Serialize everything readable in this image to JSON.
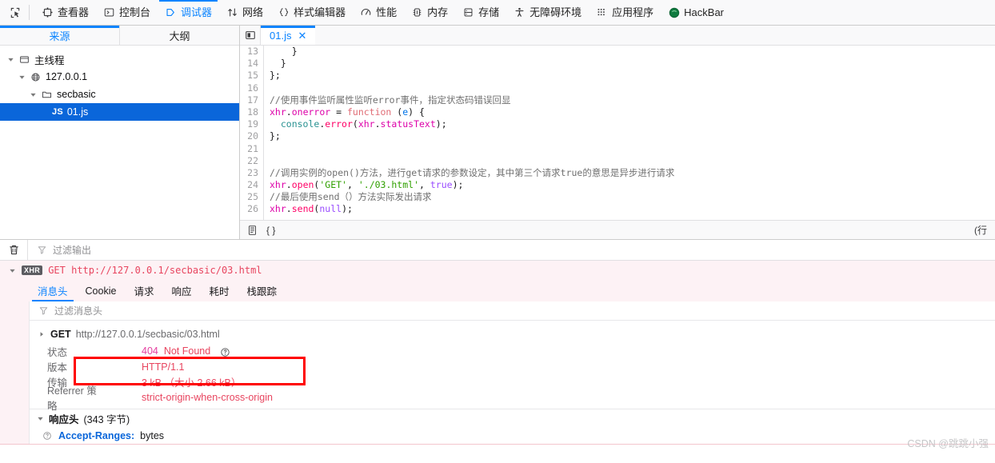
{
  "toolbar": {
    "picker_icon": "element-picker-icon",
    "items": [
      {
        "label": "查看器",
        "icon": "inspector-icon",
        "active": false
      },
      {
        "label": "控制台",
        "icon": "console-icon",
        "active": false
      },
      {
        "label": "调试器",
        "icon": "debugger-icon",
        "active": true
      },
      {
        "label": "网络",
        "icon": "network-icon",
        "active": false
      },
      {
        "label": "样式编辑器",
        "icon": "style-editor-icon",
        "active": false
      },
      {
        "label": "性能",
        "icon": "performance-icon",
        "active": false
      },
      {
        "label": "内存",
        "icon": "memory-icon",
        "active": false
      },
      {
        "label": "存储",
        "icon": "storage-icon",
        "active": false
      },
      {
        "label": "无障碍环境",
        "icon": "accessibility-icon",
        "active": false
      },
      {
        "label": "应用程序",
        "icon": "application-icon",
        "active": false
      },
      {
        "label": "HackBar",
        "icon": "hackbar-icon",
        "active": false
      }
    ]
  },
  "sources": {
    "tabs": [
      {
        "label": "来源",
        "active": true
      },
      {
        "label": "大纲",
        "active": false
      }
    ],
    "tree": [
      {
        "label": "主线程",
        "icon": "thread-icon",
        "depth": 0,
        "expanded": true,
        "selected": false
      },
      {
        "label": "127.0.0.1",
        "icon": "globe-icon",
        "depth": 1,
        "expanded": true,
        "selected": false
      },
      {
        "label": "secbasic",
        "icon": "folder-icon",
        "depth": 2,
        "expanded": true,
        "selected": false
      },
      {
        "label": "01.js",
        "icon": "js-badge",
        "badge": "JS",
        "depth": 3,
        "expanded": false,
        "selected": true
      }
    ]
  },
  "editor": {
    "toggle_icon": "panel-collapse-icon",
    "tab_name": "01.js",
    "close_label": "✕",
    "line_numbers": [
      "13",
      "14",
      "15",
      "16",
      "17",
      "18",
      "19",
      "20",
      "21",
      "22",
      "23",
      "24",
      "25",
      "26"
    ],
    "lines": [
      {
        "n": "13",
        "tokens": [
          {
            "t": "    }",
            "c": "punct"
          }
        ]
      },
      {
        "n": "14",
        "tokens": [
          {
            "t": "  }",
            "c": "punct"
          }
        ]
      },
      {
        "n": "15",
        "tokens": [
          {
            "t": "};",
            "c": "punct"
          }
        ]
      },
      {
        "n": "16",
        "tokens": []
      },
      {
        "n": "17",
        "tokens": [
          {
            "t": "//使用事件监听属性监听error事件，指定状态码错误回显",
            "c": "cmt"
          }
        ]
      },
      {
        "n": "18",
        "tokens": [
          {
            "t": "xhr",
            "c": "var"
          },
          {
            "t": ".",
            "c": "punct"
          },
          {
            "t": "onerror",
            "c": "prop"
          },
          {
            "t": " = ",
            "c": "punct"
          },
          {
            "t": "function",
            "c": "func"
          },
          {
            "t": " (",
            "c": "punct"
          },
          {
            "t": "e",
            "c": "param"
          },
          {
            "t": ") {",
            "c": "punct"
          }
        ]
      },
      {
        "n": "19",
        "tokens": [
          {
            "t": "  ",
            "c": "punct"
          },
          {
            "t": "console",
            "c": "obj"
          },
          {
            "t": ".",
            "c": "punct"
          },
          {
            "t": "error",
            "c": "fn"
          },
          {
            "t": "(",
            "c": "punct"
          },
          {
            "t": "xhr",
            "c": "var"
          },
          {
            "t": ".",
            "c": "punct"
          },
          {
            "t": "statusText",
            "c": "prop"
          },
          {
            "t": ");",
            "c": "punct"
          }
        ]
      },
      {
        "n": "20",
        "tokens": [
          {
            "t": "};",
            "c": "punct"
          }
        ]
      },
      {
        "n": "21",
        "tokens": []
      },
      {
        "n": "22",
        "tokens": []
      },
      {
        "n": "23",
        "tokens": [
          {
            "t": "//调用实例的open()方法，进行get请求的参数设定，其中第三个请求true的意思是异步进行请求",
            "c": "cmt"
          }
        ]
      },
      {
        "n": "24",
        "tokens": [
          {
            "t": "xhr",
            "c": "var"
          },
          {
            "t": ".",
            "c": "punct"
          },
          {
            "t": "open",
            "c": "fn"
          },
          {
            "t": "(",
            "c": "punct"
          },
          {
            "t": "'GET'",
            "c": "str"
          },
          {
            "t": ", ",
            "c": "punct"
          },
          {
            "t": "'./03.html'",
            "c": "str"
          },
          {
            "t": ", ",
            "c": "punct"
          },
          {
            "t": "true",
            "c": "bool"
          },
          {
            "t": ");",
            "c": "punct"
          }
        ]
      },
      {
        "n": "25",
        "tokens": [
          {
            "t": "//最后使用send（）方法实际发出请求",
            "c": "cmt"
          }
        ]
      },
      {
        "n": "26",
        "tokens": [
          {
            "t": "xhr",
            "c": "var"
          },
          {
            "t": ".",
            "c": "punct"
          },
          {
            "t": "send",
            "c": "fn"
          },
          {
            "t": "(",
            "c": "punct"
          },
          {
            "t": "null",
            "c": "bool"
          },
          {
            "t": ");",
            "c": "punct"
          }
        ]
      }
    ],
    "status": {
      "prettyprint_icon": "pretty-print-icon",
      "braces_label": "{ }",
      "right_label": "(行"
    }
  },
  "console": {
    "trash_icon": "trash-icon",
    "filter_placeholder": "过滤输出",
    "request": {
      "badge": "XHR",
      "method_url": "GET http://127.0.0.1/secbasic/03.html"
    },
    "tabs": [
      {
        "label": "消息头",
        "active": true
      },
      {
        "label": "Cookie",
        "active": false
      },
      {
        "label": "请求",
        "active": false
      },
      {
        "label": "响应",
        "active": false
      },
      {
        "label": "耗时",
        "active": false
      },
      {
        "label": "栈跟踪",
        "active": false
      }
    ],
    "headers_filter_placeholder": "过滤消息头",
    "url_row": {
      "method": "GET",
      "url": "http://127.0.0.1/secbasic/03.html"
    },
    "fields": [
      {
        "key": "状态",
        "value": "404 Not Found",
        "status_code": "404",
        "status_text": "Not Found",
        "has_help": true,
        "highlighted": true
      },
      {
        "key": "版本",
        "value": "HTTP/1.1",
        "has_help": false,
        "highlighted": false
      },
      {
        "key": "传输",
        "value": "3 kB （大小 2.66 kB）",
        "has_help": false,
        "highlighted": false
      },
      {
        "key": "Referrer 策略",
        "value": "strict-origin-when-cross-origin",
        "has_help": false,
        "highlighted": false
      }
    ],
    "response_headers": {
      "title": "响应头",
      "count": "(343 字节)",
      "rows": [
        {
          "name": "Accept-Ranges:",
          "value": "bytes",
          "help_icon": "help-icon"
        }
      ]
    }
  },
  "annotation": {
    "box_color": "#ff0000"
  },
  "watermark": {
    "text": "CSDN @跳跳小强"
  }
}
